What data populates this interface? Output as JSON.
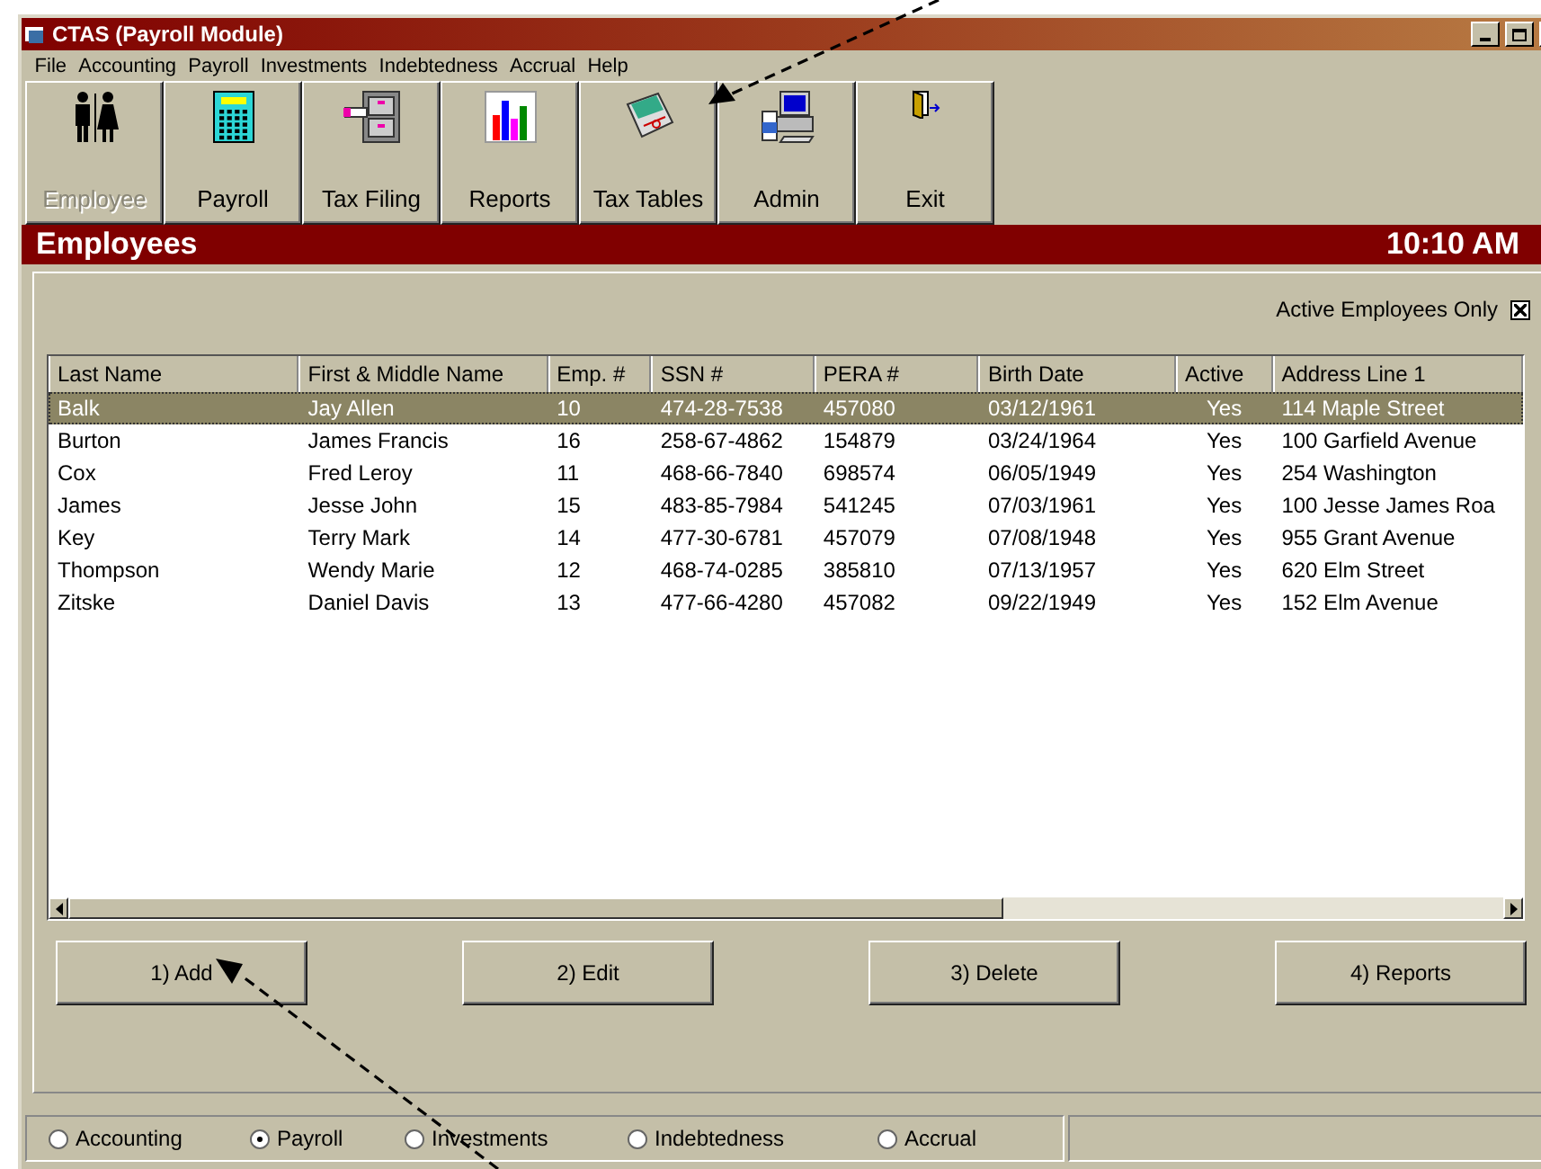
{
  "window": {
    "title": "CTAS (Payroll Module)"
  },
  "menu": [
    "File",
    "Accounting",
    "Payroll",
    "Investments",
    "Indebtedness",
    "Accrual",
    "Help"
  ],
  "toolbar": [
    {
      "label": "Employee",
      "kind": "people",
      "disabled": true
    },
    {
      "label": "Payroll",
      "kind": "calculator",
      "disabled": false
    },
    {
      "label": "Tax Filing",
      "kind": "cabinet",
      "disabled": false
    },
    {
      "label": "Reports",
      "kind": "chart",
      "disabled": false
    },
    {
      "label": "Tax Tables",
      "kind": "tables",
      "disabled": false
    },
    {
      "label": "Admin",
      "kind": "computer",
      "disabled": false
    },
    {
      "label": "Exit",
      "kind": "door",
      "disabled": false
    }
  ],
  "header": {
    "title": "Employees",
    "time": "10:10 AM"
  },
  "filter": {
    "label": "Active Employees Only",
    "checked": true
  },
  "table": {
    "columns": [
      "Last Name",
      "First & Middle Name",
      "Emp. #",
      "SSN #",
      "PERA #",
      "Birth Date",
      "Active",
      "Address Line 1"
    ],
    "rows": [
      {
        "cells": [
          "Balk",
          "Jay Allen",
          "10",
          "474-28-7538",
          "457080",
          "03/12/1961",
          "Yes",
          "114 Maple Street"
        ],
        "selected": true
      },
      {
        "cells": [
          "Burton",
          "James Francis",
          "16",
          "258-67-4862",
          "154879",
          "03/24/1964",
          "Yes",
          "100 Garfield Avenue"
        ],
        "selected": false
      },
      {
        "cells": [
          "Cox",
          "Fred Leroy",
          "11",
          "468-66-7840",
          "698574",
          "06/05/1949",
          "Yes",
          "254 Washington"
        ],
        "selected": false
      },
      {
        "cells": [
          "James",
          "Jesse John",
          "15",
          "483-85-7984",
          "541245",
          "07/03/1961",
          "Yes",
          "100 Jesse James Roa"
        ],
        "selected": false
      },
      {
        "cells": [
          "Key",
          "Terry Mark",
          "14",
          "477-30-6781",
          "457079",
          "07/08/1948",
          "Yes",
          "955 Grant Avenue"
        ],
        "selected": false
      },
      {
        "cells": [
          "Thompson",
          "Wendy Marie",
          "12",
          "468-74-0285",
          "385810",
          "07/13/1957",
          "Yes",
          "620 Elm Street"
        ],
        "selected": false
      },
      {
        "cells": [
          "Zitske",
          "Daniel Davis",
          "13",
          "477-66-4280",
          "457082",
          "09/22/1949",
          "Yes",
          "152 Elm Avenue"
        ],
        "selected": false
      }
    ]
  },
  "buttons": [
    "1) Add",
    "2) Edit",
    "3) Delete",
    "4) Reports"
  ],
  "modules": [
    {
      "label": "Accounting",
      "selected": false
    },
    {
      "label": "Payroll",
      "selected": true
    },
    {
      "label": "Investments",
      "selected": false
    },
    {
      "label": "Indebtedness",
      "selected": false
    },
    {
      "label": "Accrual",
      "selected": false
    }
  ]
}
